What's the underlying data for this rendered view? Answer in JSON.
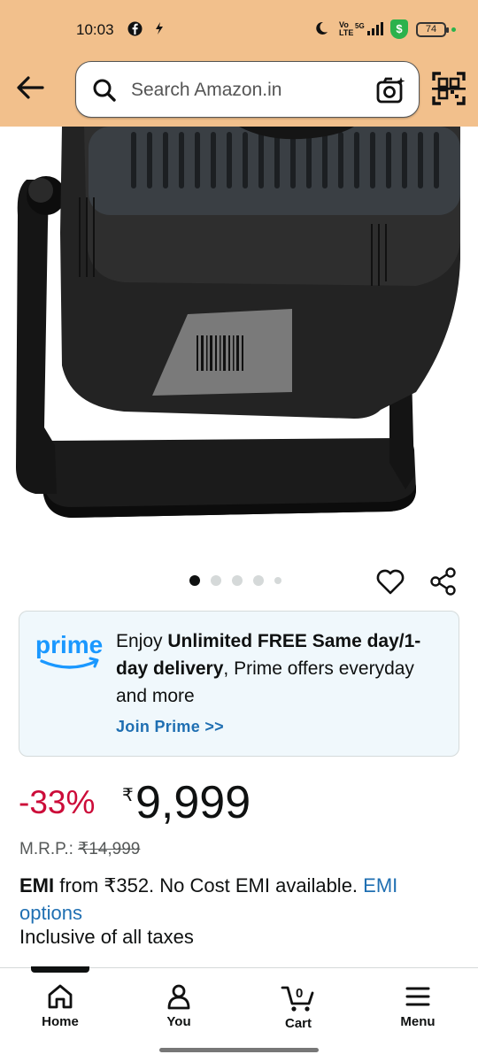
{
  "status_bar": {
    "time": "10:03",
    "battery": "74",
    "icons": [
      "facebook-icon",
      "flash-icon",
      "moon-icon",
      "volte-icon",
      "5g-signal-icon",
      "shield-icon"
    ]
  },
  "header": {
    "search_placeholder": "Search Amazon.in",
    "background_color": "#f2c08c"
  },
  "carousel": {
    "total_images": 5,
    "active_index": 0
  },
  "prime_banner": {
    "logo_text": "prime",
    "text_prefix": "Enjoy ",
    "text_bold": "Unlimited FREE Same day/1-day delivery",
    "text_suffix": ", Prime offers everyday and more",
    "cta": "Join Prime >>"
  },
  "pricing": {
    "discount": "-33%",
    "currency_symbol": "₹",
    "price": "9,999",
    "mrp_label": "M.R.P.:",
    "mrp_value": "₹14,999",
    "emi_bold": "EMI",
    "emi_text": " from ₹352. No Cost EMI available. ",
    "emi_link": "EMI options",
    "taxes": "Inclusive of all taxes"
  },
  "bottom_nav": {
    "items": [
      {
        "label": "Home",
        "icon": "home-icon"
      },
      {
        "label": "You",
        "icon": "user-icon"
      },
      {
        "label": "Cart",
        "icon": "cart-icon",
        "badge": "0"
      },
      {
        "label": "Menu",
        "icon": "menu-icon"
      }
    ],
    "active_index": 0
  },
  "colors": {
    "accent_link": "#1f6fb2",
    "discount_red": "#cc0c39",
    "prime_bg": "#f0f8fc"
  }
}
